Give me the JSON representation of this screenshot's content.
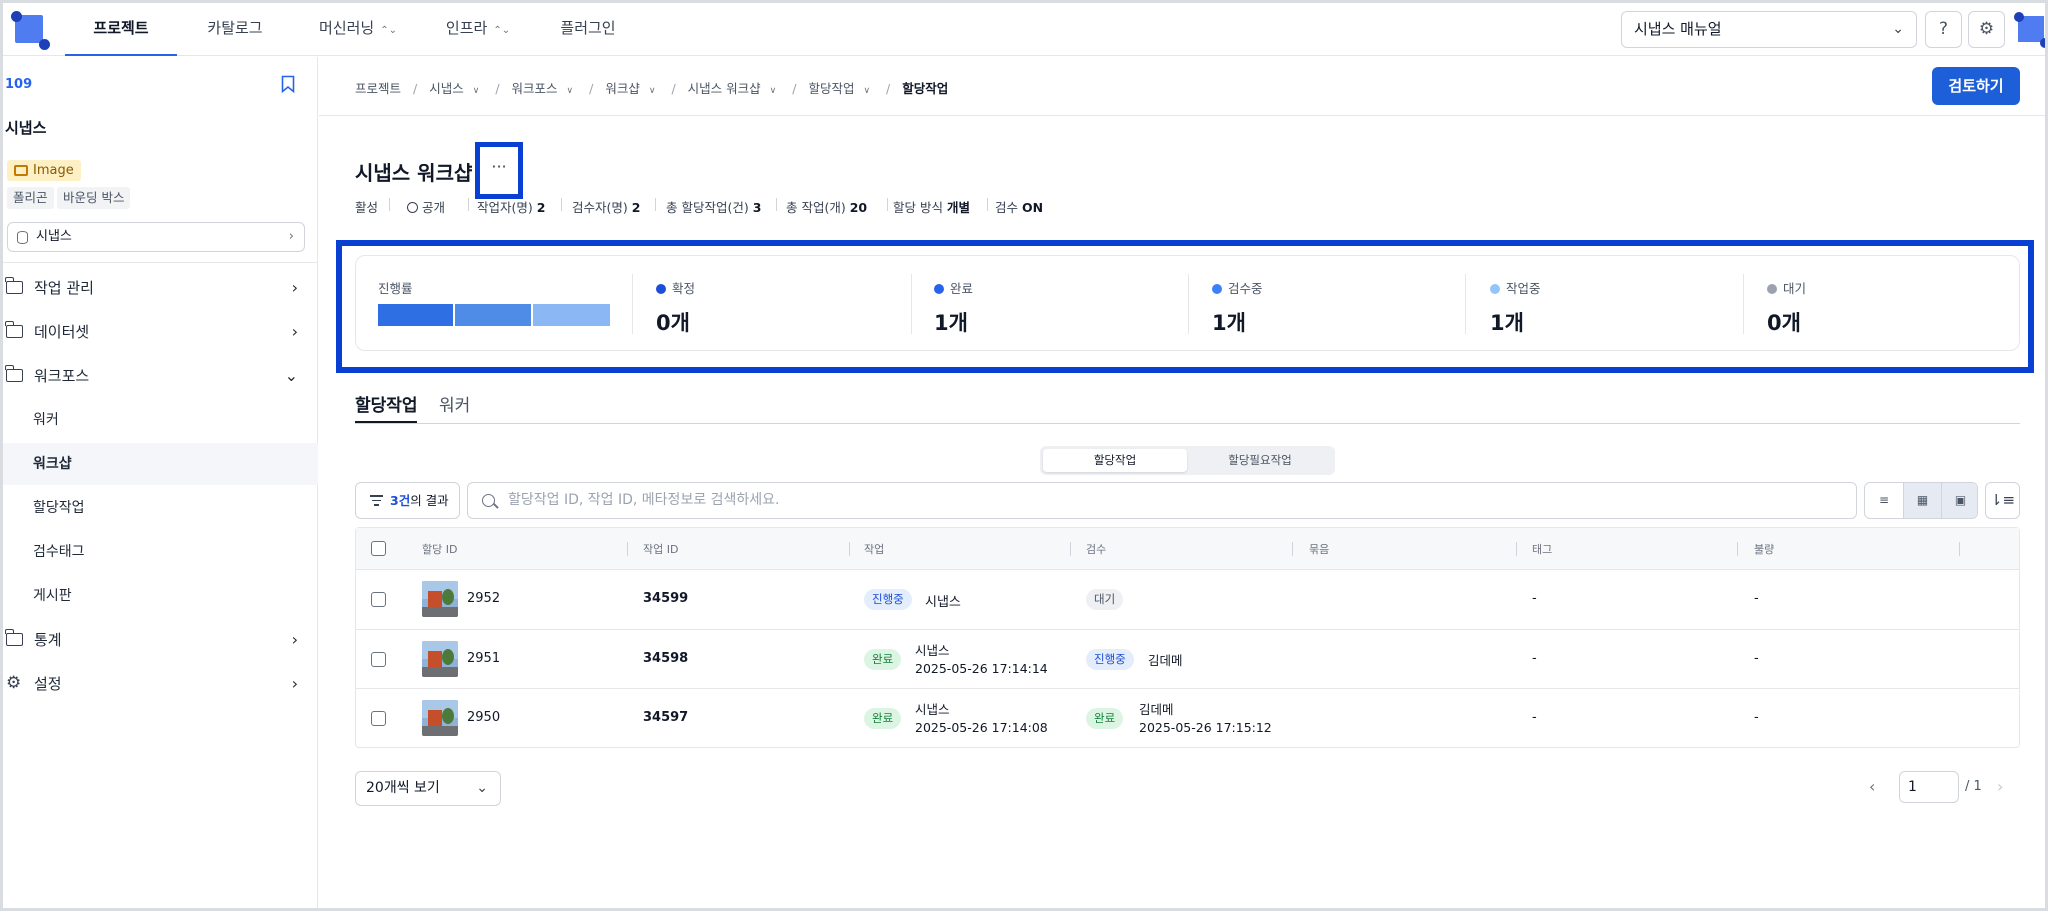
{
  "topnav": {
    "items": [
      {
        "label": "프로젝트",
        "active": true
      },
      {
        "label": "카탈로그",
        "active": false
      },
      {
        "label": "머신러닝",
        "active": false
      },
      {
        "label": "인프라",
        "active": false
      },
      {
        "label": "플러그인",
        "active": false
      }
    ],
    "manual_select": "시냅스 매뉴얼",
    "help_icon": "question-circle-icon",
    "settings_icon": "gear-icon"
  },
  "sidebar": {
    "project_id": "109",
    "project_name": "시냅스",
    "type_badge": "Image",
    "tags": [
      "폴리곤",
      "바운딩 박스"
    ],
    "dataset": "시냅스",
    "menu": {
      "task_mgmt": "작업 관리",
      "dataset": "데이터셋",
      "workforce": "워크포스",
      "sub": [
        "워커",
        "워크샵",
        "할당작업",
        "검수태그",
        "게시판"
      ],
      "stats": "통계",
      "settings": "설정"
    }
  },
  "breadcrumb": {
    "items": [
      "프로젝트",
      "시냅스",
      "워크포스",
      "워크샵",
      "시냅스 워크샵",
      "할당작업"
    ],
    "current": "할당작업"
  },
  "review_button": "검토하기",
  "workshop": {
    "title": "시냅스 워크샵",
    "more": "···",
    "meta": {
      "status": "활성",
      "visibility": "공개",
      "workers_label": "작업자(명)",
      "workers": "2",
      "reviewers_label": "검수자(명)",
      "reviewers": "2",
      "total_assign_label": "총 할당작업(건)",
      "total_assign": "3",
      "total_tasks_label": "총 작업(개)",
      "total_tasks": "20",
      "method_label": "할당 방식",
      "method": "개별",
      "review_label": "검수",
      "review": "ON"
    }
  },
  "stats": {
    "progress_label": "진행률",
    "progress_segments": [
      {
        "fraction": 0.333,
        "color": "#2f6fe4"
      },
      {
        "fraction": 0.333,
        "color": "#4f8ce8"
      },
      {
        "fraction": 0.334,
        "color": "#8bb8f5"
      }
    ],
    "items": [
      {
        "label": "확정",
        "value": "0개",
        "color": "#1d4ed8"
      },
      {
        "label": "완료",
        "value": "1개",
        "color": "#2563eb"
      },
      {
        "label": "검수중",
        "value": "1개",
        "color": "#3b82f6"
      },
      {
        "label": "작업중",
        "value": "1개",
        "color": "#93c5fd"
      },
      {
        "label": "대기",
        "value": "0개",
        "color": "#9ca3af"
      }
    ]
  },
  "tabs": [
    "할당작업",
    "워커"
  ],
  "toggle": [
    "할당작업",
    "할당필요작업"
  ],
  "toolbar": {
    "result_count": "3건",
    "result_suffix": "의 결과",
    "search_placeholder": "할당작업 ID, 작업 ID, 메타정보로 검색하세요."
  },
  "table": {
    "headers": [
      "할당 ID",
      "작업 ID",
      "작업",
      "검수",
      "묶음",
      "태그",
      "불량"
    ],
    "rows": [
      {
        "assign_id": "2952",
        "task_id": "34599",
        "task_status": "진행중",
        "task_status_color": "blue",
        "task_worker": "시냅스",
        "task_time": "",
        "review_status": "대기",
        "review_status_color": "gray",
        "reviewer": "",
        "review_time": "",
        "tag": "-",
        "defect": "-"
      },
      {
        "assign_id": "2951",
        "task_id": "34598",
        "task_status": "완료",
        "task_status_color": "green",
        "task_worker": "시냅스",
        "task_time": "2025-05-26 17:14:14",
        "review_status": "진행중",
        "review_status_color": "blue",
        "reviewer": "김데메",
        "review_time": "",
        "tag": "-",
        "defect": "-"
      },
      {
        "assign_id": "2950",
        "task_id": "34597",
        "task_status": "완료",
        "task_status_color": "green",
        "task_worker": "시냅스",
        "task_time": "2025-05-26 17:14:08",
        "review_status": "완료",
        "review_status_color": "green",
        "reviewer": "김데메",
        "review_time": "2025-05-26 17:15:12",
        "tag": "-",
        "defect": "-"
      }
    ]
  },
  "pagination": {
    "page_size": "20개씩 보기",
    "current_page": "1",
    "total": "/ 1"
  }
}
